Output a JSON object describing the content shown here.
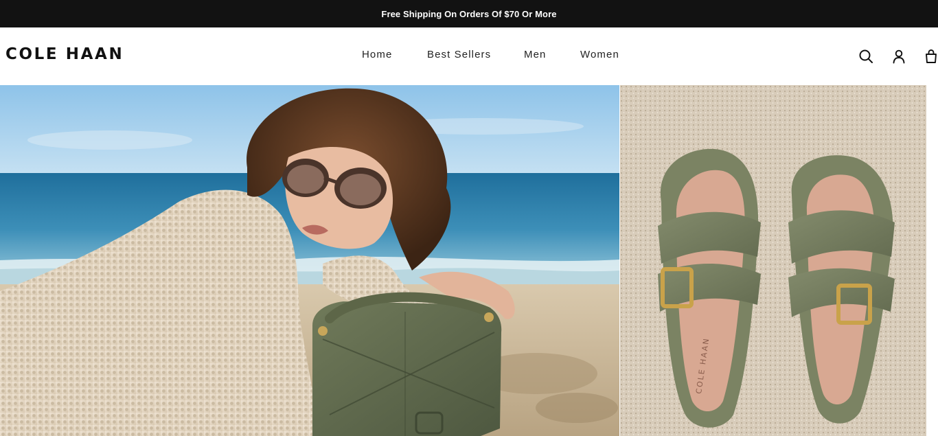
{
  "announcement": {
    "text": "Free Shipping On Orders Of $70 Or More"
  },
  "header": {
    "logo": "COLE HAAN",
    "nav": [
      {
        "label": "Home"
      },
      {
        "label": "Best Sellers"
      },
      {
        "label": "Men"
      },
      {
        "label": "Women"
      }
    ],
    "icons": [
      "search-icon",
      "account-icon",
      "cart-icon"
    ]
  },
  "hero": {
    "left_image": "woman-on-beach-with-green-quilted-bag",
    "right_image": "olive-sandals-on-sand",
    "sandal_insole_text": "COLE HAAN"
  },
  "colors": {
    "announcement_bg": "#121212",
    "text": "#111111",
    "olive": "#6f775c"
  }
}
